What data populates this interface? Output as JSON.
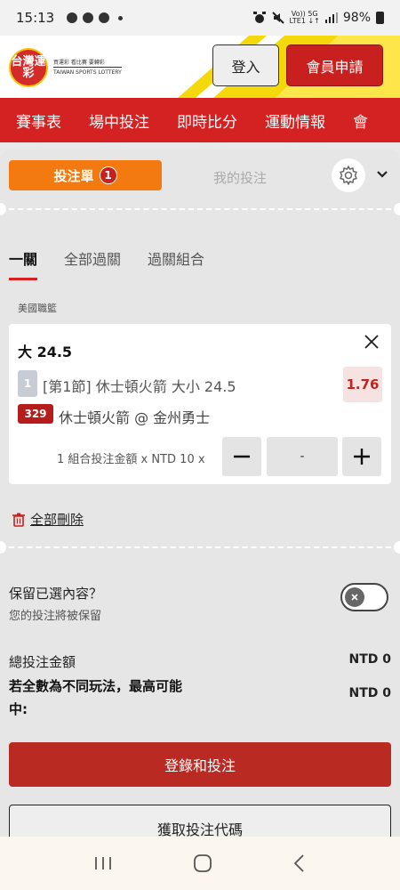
{
  "status_bar": {
    "time": "15:13",
    "network_top": "Vo)) 5G",
    "network_bottom": "LTE1 ↓↑",
    "battery": "98%"
  },
  "header": {
    "logo_main": "台灣運彩",
    "logo_tagline": "買運彩 看比賽 要轉彩",
    "logo_subtitle": "TAIWAN SPORTS LOTTERY",
    "login_label": "登入",
    "register_label": "會員申請"
  },
  "nav": {
    "items": [
      "賽事表",
      "場中投注",
      "即時比分",
      "運動情報",
      "會"
    ]
  },
  "slip": {
    "tab_label": "投注單",
    "tab_badge": "1",
    "my_bets_label": "我的投注",
    "subtabs": [
      "一關",
      "全部過關",
      "過關組合"
    ],
    "league": "美國職籃",
    "bet": {
      "title": "大 24.5",
      "leg_number": "1",
      "leg_description": "[第1節] 休士頓火箭 大小 24.5",
      "odds": "1.76",
      "game_id": "329",
      "matchup": "休士頓火箭 @ 金州勇士",
      "stake_label": "1 組合投注金額 x NTD 10 x",
      "stake_value": "-",
      "minus_label": "—",
      "plus_label": "+"
    },
    "delete_all_label": "全部刪除",
    "keep_title": "保留已選內容？",
    "keep_subtitle": "您的投注將被保留",
    "total_label": "總投注金額",
    "total_value": "NTD 0",
    "max_label": "若全數為不同玩法，最高可能中:",
    "max_value": "NTD 0",
    "place_bet_label": "登錄和投注",
    "get_code_label": "獲取投注代碼"
  },
  "colors": {
    "brand_red": "#d42222",
    "accent_orange": "#f37a10",
    "odds_red": "#c8201e"
  }
}
